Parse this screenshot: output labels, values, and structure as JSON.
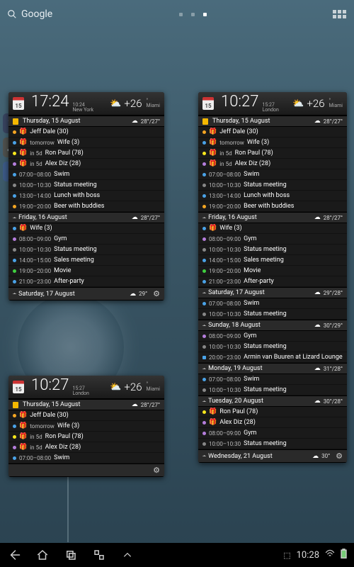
{
  "topbar": {
    "search_label": "Google"
  },
  "navbar": {
    "clock": "10:28"
  },
  "bg_icons": {
    "calendar_day": "15"
  },
  "weather_temp": "+26",
  "weather_city": "Miami",
  "widgets": {
    "A": {
      "clock_big": "17:24",
      "clock_small_time": "10:24",
      "clock_small_city": "New York",
      "cal_day": "15",
      "days": [
        {
          "label": "Thursday, 15 August",
          "today": true,
          "hilo": "28°/27°",
          "rows": [
            {
              "color": "c-orange",
              "gift": true,
              "text": "Jeff Dale (30)"
            },
            {
              "color": "c-blue",
              "gift": true,
              "prefix": "tomorrow",
              "text": "Wife (3)"
            },
            {
              "color": "c-yellow",
              "gift": true,
              "prefix": "in 5d",
              "text": "Ron Paul (78)"
            },
            {
              "color": "c-purple",
              "gift": true,
              "prefix": "in 5d",
              "text": "Alex Diz (28)"
            },
            {
              "color": "c-blue",
              "time": "07:00–08:00",
              "text": "Swim"
            },
            {
              "color": "c-gray",
              "time": "10:00–10:30",
              "text": "Status meeting"
            },
            {
              "color": "c-blue",
              "time": "13:00–14:00",
              "text": "Lunch with boss"
            },
            {
              "color": "c-orange",
              "time": "19:00–20:00",
              "text": "Beer with buddies"
            }
          ]
        },
        {
          "label": "Friday, 16 August",
          "hilo": "28°/27°",
          "rows": [
            {
              "color": "c-blue",
              "gift": true,
              "text": "Wife (3)"
            },
            {
              "color": "c-purple",
              "time": "08:00–09:00",
              "text": "Gym"
            },
            {
              "color": "c-gray",
              "time": "10:00–10:30",
              "text": "Status meeting"
            },
            {
              "color": "c-blue",
              "time": "14:00–15:00",
              "text": "Sales meeting"
            },
            {
              "color": "c-green",
              "time": "19:00–20:00",
              "text": "Movie"
            },
            {
              "color": "c-blue",
              "time": "21:00–23:00",
              "text": "After-party"
            }
          ]
        },
        {
          "label": "Saturday, 17 August",
          "hilo": "29°",
          "gear": true,
          "rows": []
        }
      ]
    },
    "B": {
      "clock_big": "10:27",
      "clock_small_time": "15:27",
      "clock_small_city": "London",
      "cal_day": "15",
      "days": [
        {
          "label": "Thursday, 15 August",
          "today": true,
          "hilo": "28°/27°",
          "rows": [
            {
              "color": "c-orange",
              "gift": true,
              "text": "Jeff Dale (30)"
            },
            {
              "color": "c-blue",
              "gift": true,
              "prefix": "tomorrow",
              "text": "Wife (3)"
            },
            {
              "color": "c-yellow",
              "gift": true,
              "prefix": "in 5d",
              "text": "Ron Paul (78)"
            },
            {
              "color": "c-purple",
              "gift": true,
              "prefix": "in 5d",
              "text": "Alex Diz (28)"
            },
            {
              "color": "c-blue",
              "time": "07:00–08:00",
              "text": "Swim"
            },
            {
              "color": "c-gray",
              "time": "10:00–10:30",
              "text": "Status meeting"
            },
            {
              "color": "c-blue",
              "time": "13:00–14:00",
              "text": "Lunch with boss"
            },
            {
              "color": "c-orange",
              "time": "19:00–20:00",
              "text": "Beer with buddies"
            }
          ]
        },
        {
          "label": "Friday, 16 August",
          "hilo": "28°/27°",
          "rows": [
            {
              "color": "c-blue",
              "gift": true,
              "text": "Wife (3)"
            },
            {
              "color": "c-purple",
              "time": "08:00–09:00",
              "text": "Gym"
            },
            {
              "color": "c-gray",
              "time": "10:00–10:30",
              "text": "Status meeting"
            },
            {
              "color": "c-blue",
              "time": "14:00–15:00",
              "text": "Sales meeting"
            },
            {
              "color": "c-green",
              "time": "19:00–20:00",
              "text": "Movie"
            },
            {
              "color": "c-blue",
              "time": "21:00–23:00",
              "text": "After-party"
            }
          ]
        },
        {
          "label": "Saturday, 17 August",
          "hilo": "29°/28°",
          "rows": [
            {
              "color": "c-blue",
              "time": "07:00–08:00",
              "text": "Swim"
            },
            {
              "color": "c-gray",
              "time": "10:00–10:30",
              "text": "Status meeting"
            }
          ]
        },
        {
          "label": "Sunday, 18 August",
          "hilo": "30°/29°",
          "rows": [
            {
              "color": "c-purple",
              "time": "08:00–09:00",
              "text": "Gym"
            },
            {
              "color": "c-gray",
              "time": "10:00–10:30",
              "text": "Status meeting"
            },
            {
              "color": "c-blue",
              "square": true,
              "time": "20:00–23:00",
              "text": "Armin van Buuren at Lizard Lounge"
            }
          ]
        },
        {
          "label": "Monday, 19 August",
          "hilo": "31°/28°",
          "rows": [
            {
              "color": "c-blue",
              "time": "07:00–08:00",
              "text": "Swim"
            },
            {
              "color": "c-gray",
              "time": "10:00–10:30",
              "text": "Status meeting"
            }
          ]
        },
        {
          "label": "Tuesday, 20 August",
          "hilo": "30°/28°",
          "rows": [
            {
              "color": "c-yellow",
              "gift": true,
              "text": "Ron Paul (78)"
            },
            {
              "color": "c-purple",
              "gift": true,
              "text": "Alex Diz (28)"
            },
            {
              "color": "c-purple",
              "time": "08:00–09:00",
              "text": "Gym"
            },
            {
              "color": "c-gray",
              "time": "10:00–10:30",
              "text": "Status meeting"
            }
          ]
        },
        {
          "label": "Wednesday, 21 August",
          "hilo": "30°",
          "gear": true,
          "rows": []
        }
      ]
    },
    "C": {
      "clock_big": "10:27",
      "clock_small_time": "15:27",
      "clock_small_city": "London",
      "cal_day": "15",
      "days": [
        {
          "label": "Thursday, 15 August",
          "today": true,
          "hilo": "28°/27°",
          "rows": [
            {
              "color": "c-orange",
              "gift": true,
              "text": "Jeff Dale (30)"
            },
            {
              "color": "c-blue",
              "gift": true,
              "prefix": "tomorrow",
              "text": "Wife (3)"
            },
            {
              "color": "c-yellow",
              "gift": true,
              "prefix": "in 5d",
              "text": "Ron Paul (78)"
            },
            {
              "color": "c-purple",
              "gift": true,
              "prefix": "in 5d",
              "text": "Alex Diz (28)"
            },
            {
              "color": "c-blue",
              "time": "07:00–08:00",
              "text": "Swim"
            }
          ]
        }
      ],
      "bottom_gear": true
    }
  }
}
